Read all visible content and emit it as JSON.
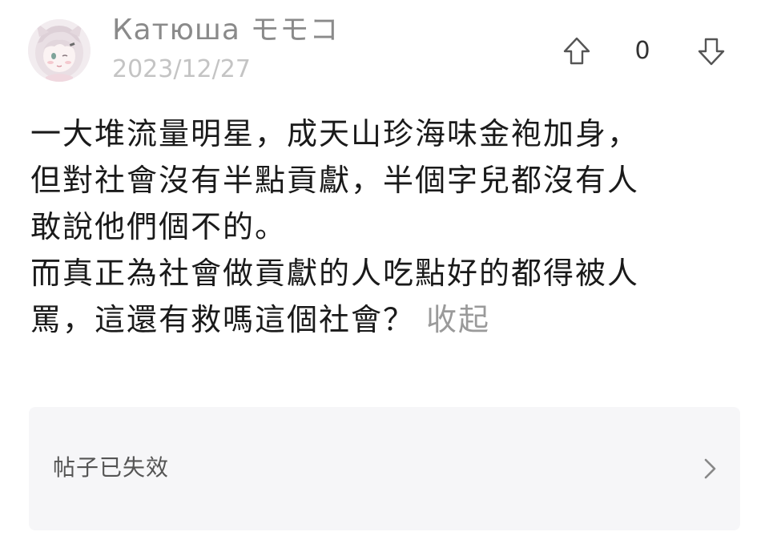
{
  "user": {
    "name": "Катюша モモコ",
    "date": "2023/12/27",
    "avatar_icon": "anime-girl-avatar"
  },
  "votes": {
    "up_icon": "arrow-up-icon",
    "count": "0",
    "down_icon": "arrow-down-icon"
  },
  "comment": {
    "lines": [
      "一大堆流量明星，成天山珍海味金袍加身，",
      "但對社會沒有半點貢獻，半個字兒都沒有人",
      "敢說他們個不的。",
      "而真正為社會做貢獻的人吃點好的都得被人",
      "罵，這還有救嗎這個社會？"
    ],
    "collapse_label": "收起"
  },
  "linked_post": {
    "label": "帖子已失效",
    "chevron_icon": "chevron-right-icon"
  },
  "colors": {
    "card_background": "#f6f6f8",
    "muted_text": "#9a9a9a",
    "body_text": "#1a1a1a"
  }
}
